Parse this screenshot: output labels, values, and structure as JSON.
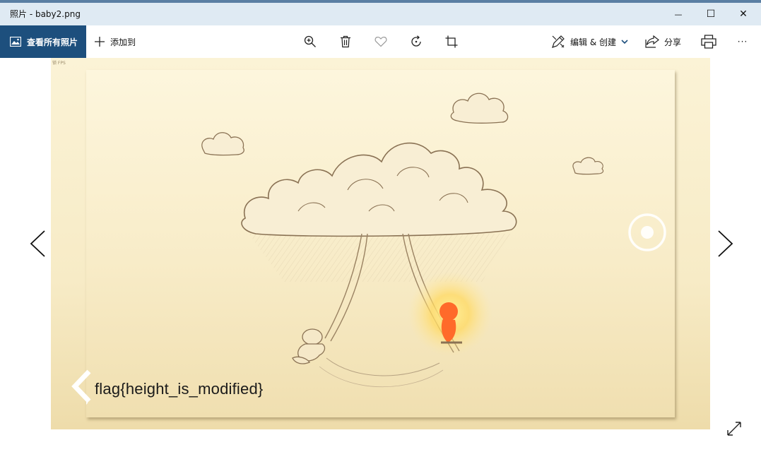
{
  "window": {
    "title": "照片 - baby2.png",
    "minimize_glyph": "—",
    "maximize_glyph": "☐",
    "close_glyph": "✕"
  },
  "toolbar": {
    "all_photos_label": "查看所有照片",
    "add_to_label": "添加到",
    "edit_create_label": "编辑 & 创建",
    "share_label": "分享",
    "more_glyph": "···"
  },
  "photo": {
    "watermark": "锁 FPS",
    "flag_text": "flag{height_is_modified}",
    "colors": {
      "background": "#f7ebc6",
      "sketch": "#8a7254",
      "glow": "#ffce4a",
      "child": "#ff6a2a"
    }
  },
  "icons": {
    "photos": "photos-icon",
    "add": "plus-icon",
    "zoom": "zoom-in-icon",
    "delete": "trash-icon",
    "favorite": "heart-icon",
    "rotate": "rotate-icon",
    "crop": "crop-icon",
    "edit": "edit-create-icon",
    "share": "share-icon",
    "print": "print-icon",
    "expand": "expand-icon"
  },
  "accent_color": "#1d4f7d"
}
